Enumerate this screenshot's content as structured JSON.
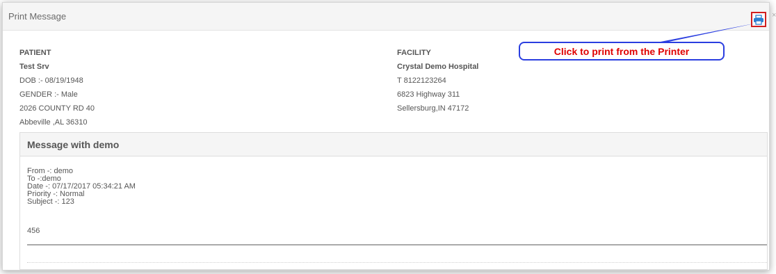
{
  "dialog": {
    "title": "Print Message",
    "print_icon": "printer-icon",
    "close_label": "×"
  },
  "callout": {
    "text": "Click to print from the Printer",
    "border_color": "#2a3ee0",
    "text_color": "#e00000"
  },
  "patient": {
    "heading": "PATIENT",
    "name": "Test Srv",
    "dob": "DOB :- 08/19/1948",
    "gender": "GENDER :- Male",
    "address1": "2026 COUNTY RD 40",
    "address2": "Abbeville ,AL 36310"
  },
  "facility": {
    "heading": "FACILITY",
    "name": "Crystal Demo Hospital",
    "phone": "T 8122123264",
    "address1": "6823 Highway 311",
    "address2": "Sellersburg,IN 47172"
  },
  "message": {
    "title": "Message with demo",
    "from": "From -: demo",
    "to": "To -:demo",
    "date": "Date -: 07/17/2017 05:34:21 AM",
    "priority": "Priority -: Normal",
    "subject": "Subject -: 123",
    "body": "456"
  }
}
